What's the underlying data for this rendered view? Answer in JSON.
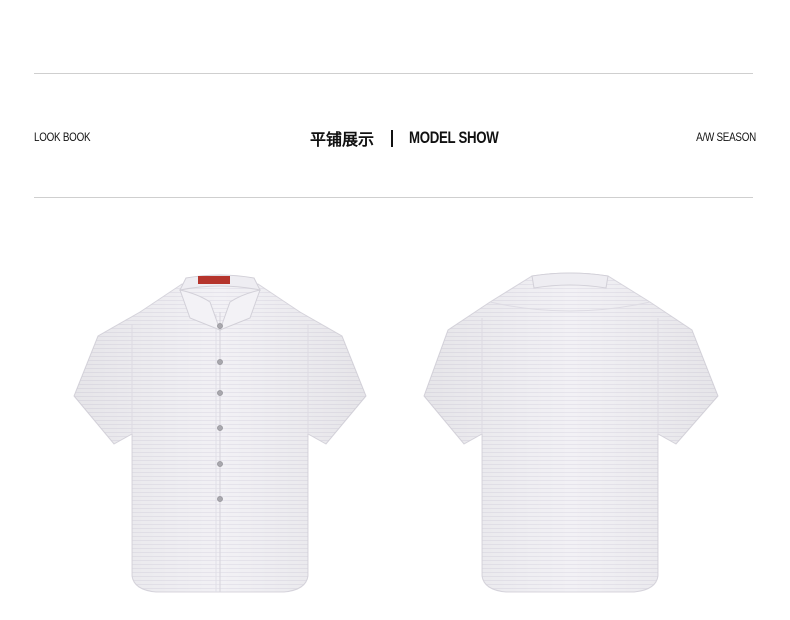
{
  "header": {
    "left_label": "LOOK BOOK",
    "title_cn": "平铺展示",
    "title_en": "MODEL SHOW",
    "right_label": "A/W SEASON"
  },
  "products": {
    "front_view": {
      "color": "#f1f0f4",
      "button_count": 6
    },
    "back_view": {
      "color": "#f1f0f4"
    }
  },
  "colors": {
    "rule": "#cfcfcf",
    "text": "#111111",
    "label_tag": "#b5342c"
  }
}
